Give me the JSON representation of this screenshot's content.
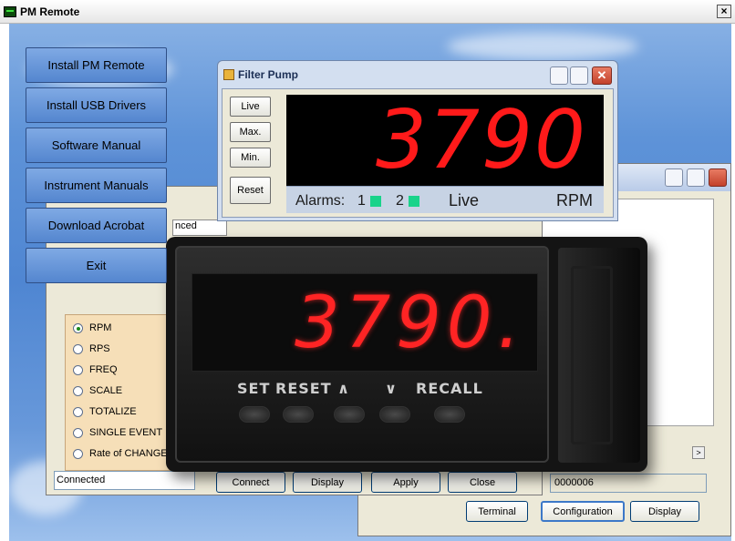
{
  "main_window": {
    "title": "PM Remote",
    "close_glyph": "×"
  },
  "menu": {
    "items": [
      {
        "label": "Install PM Remote"
      },
      {
        "label": "Install USB Drivers"
      },
      {
        "label": "Software Manual"
      },
      {
        "label": "Instrument Manuals"
      },
      {
        "label": "Download Acrobat"
      },
      {
        "label": "Exit"
      }
    ]
  },
  "filter_pump": {
    "title": "Filter Pump",
    "buttons": {
      "live": "Live",
      "max": "Max.",
      "min": "Min.",
      "reset": "Reset"
    },
    "value": "3790",
    "status": {
      "alarms_label": "Alarms:",
      "alarm_1": "1",
      "alarm_2": "2",
      "mode": "Live",
      "unit": "RPM",
      "alarm_color": "#19d38a"
    },
    "display_color": "#ff1a1a",
    "close_glyph": "✕"
  },
  "config_window": {
    "tab_partial": "nced",
    "radio_options": [
      {
        "label": "RPM",
        "selected": true
      },
      {
        "label": "RPS",
        "selected": false
      },
      {
        "label": "FREQ",
        "selected": false
      },
      {
        "label": "SCALE",
        "selected": false
      },
      {
        "label": "TOTALIZE",
        "selected": false
      },
      {
        "label": "SINGLE EVENT",
        "selected": false
      },
      {
        "label": "Rate of CHANGE",
        "selected": false
      }
    ],
    "status_text": "Connected",
    "buttons": {
      "connect": "Connect",
      "display": "Display",
      "apply": "Apply",
      "close": "Close"
    }
  },
  "right_window": {
    "counter": "0000006",
    "scroll_arrow": ">",
    "buttons": {
      "terminal": "Terminal",
      "configuration": "Configuration",
      "display": "Display"
    }
  },
  "meter": {
    "value": "3790.",
    "keys": [
      "SET",
      "RESET",
      "∧",
      "∨",
      "RECALL"
    ],
    "display_color": "#ff2424"
  }
}
